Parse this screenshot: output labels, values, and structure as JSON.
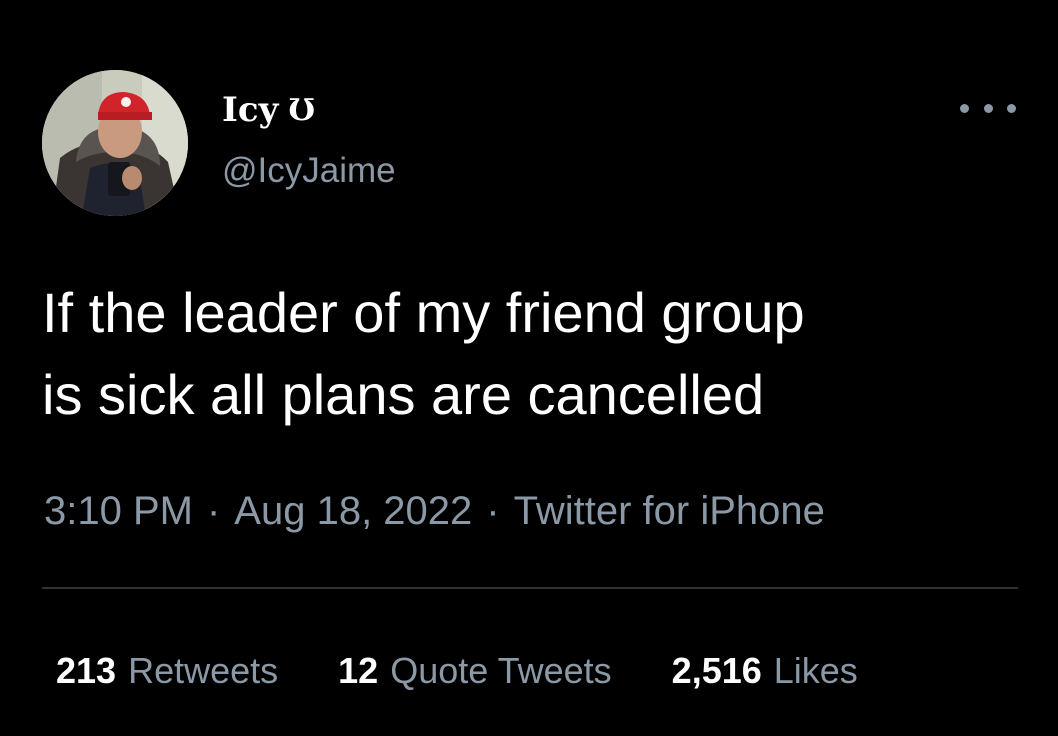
{
  "tweet": {
    "author": {
      "display_name": "Icy",
      "name_glyph": "Ʊ",
      "handle": "@IcyJaime"
    },
    "text_lines": [
      "If the leader of my friend group",
      "is sick all plans are cancelled"
    ],
    "time": "3:10 PM",
    "date": "Aug 18, 2022",
    "source": "Twitter for iPhone",
    "separator": "·",
    "stats": {
      "retweets_count": "213",
      "retweets_label": "Retweets",
      "quotes_count": "12",
      "quotes_label": "Quote Tweets",
      "likes_count": "2,516",
      "likes_label": "Likes"
    }
  },
  "icons": {
    "more": "more-horizontal-icon",
    "avatar": "avatar-photo"
  },
  "colors": {
    "background": "#000000",
    "primary_text": "#ffffff",
    "secondary_text": "#8b98a5",
    "divider": "#2f3336"
  }
}
